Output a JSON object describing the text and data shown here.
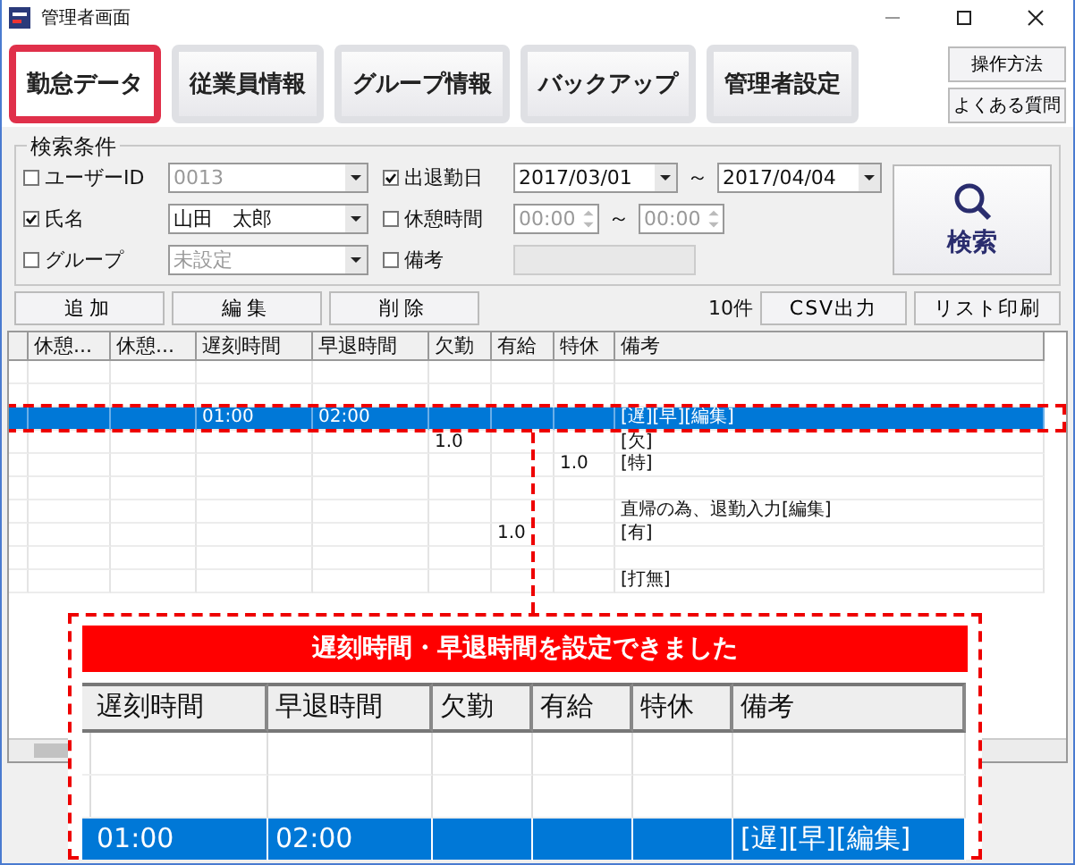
{
  "window": {
    "title": "管理者画面"
  },
  "nav": [
    {
      "label": "勤怠データ",
      "selected": true
    },
    {
      "label": "従業員情報",
      "selected": false
    },
    {
      "label": "グループ情報",
      "selected": false
    },
    {
      "label": "バックアップ",
      "selected": false
    },
    {
      "label": "管理者設定",
      "selected": false
    }
  ],
  "help_buttons": [
    "操作方法",
    "よくある質問"
  ],
  "search": {
    "legend": "検索条件",
    "conditions": [
      {
        "kind": "combo",
        "label": "ユーザーID",
        "checked": false,
        "value": "0013"
      },
      {
        "kind": "date-range",
        "label": "出退勤日",
        "checked": true,
        "from": "2017/03/01",
        "separator": "～",
        "to": "2017/04/04"
      },
      {
        "kind": "combo",
        "label": "氏名",
        "checked": true,
        "value": "山田　太郎"
      },
      {
        "kind": "time-range",
        "label": "休憩時間",
        "checked": false,
        "from": "00:00",
        "separator": "～",
        "to": "00:00"
      },
      {
        "kind": "combo",
        "label": "グループ",
        "checked": false,
        "value": "未設定"
      },
      {
        "kind": "text",
        "label": "備考",
        "checked": false
      }
    ],
    "button": "検索"
  },
  "actions": [
    "追加",
    "編集",
    "削除"
  ],
  "count": "10件",
  "export_buttons": [
    "CSV出力",
    "リスト印刷"
  ],
  "table": {
    "columns": [
      "休憩...",
      "休憩...",
      "遅刻時間",
      "早退時間",
      "欠勤",
      "有給",
      "特休",
      "備考"
    ],
    "rows": [
      {
        "selected": false
      },
      {
        "selected": false
      },
      {
        "selected": true,
        "cells": [
          null,
          null,
          "01:00",
          "02:00",
          null,
          null,
          null,
          "[遅][早][編集]"
        ]
      },
      {
        "selected": false,
        "cells": [
          null,
          null,
          null,
          null,
          "1.0",
          null,
          null,
          "[欠]"
        ]
      },
      {
        "selected": false,
        "cells": [
          null,
          null,
          null,
          null,
          null,
          null,
          "1.0",
          "[特]"
        ]
      },
      {
        "selected": false
      },
      {
        "selected": false,
        "cells": [
          null,
          null,
          null,
          null,
          null,
          null,
          null,
          "直帰の為、退勤入力[編集]"
        ]
      },
      {
        "selected": false,
        "cells": [
          null,
          null,
          null,
          null,
          null,
          "1.0",
          null,
          "[有]"
        ]
      },
      {
        "selected": false
      },
      {
        "selected": false,
        "cells": [
          null,
          null,
          null,
          null,
          null,
          null,
          null,
          "[打無]"
        ]
      }
    ]
  },
  "callout": {
    "message": "遅刻時間・早退時間を設定できました",
    "columns": [
      "遅刻時間",
      "早退時間",
      "欠勤",
      "有給",
      "特休",
      "備考"
    ],
    "rows": [
      {
        "selected": false
      },
      {
        "selected": false
      },
      {
        "selected": true,
        "cells": [
          "01:00",
          "02:00",
          null,
          null,
          null,
          "[遅][早][編集]"
        ]
      }
    ]
  }
}
